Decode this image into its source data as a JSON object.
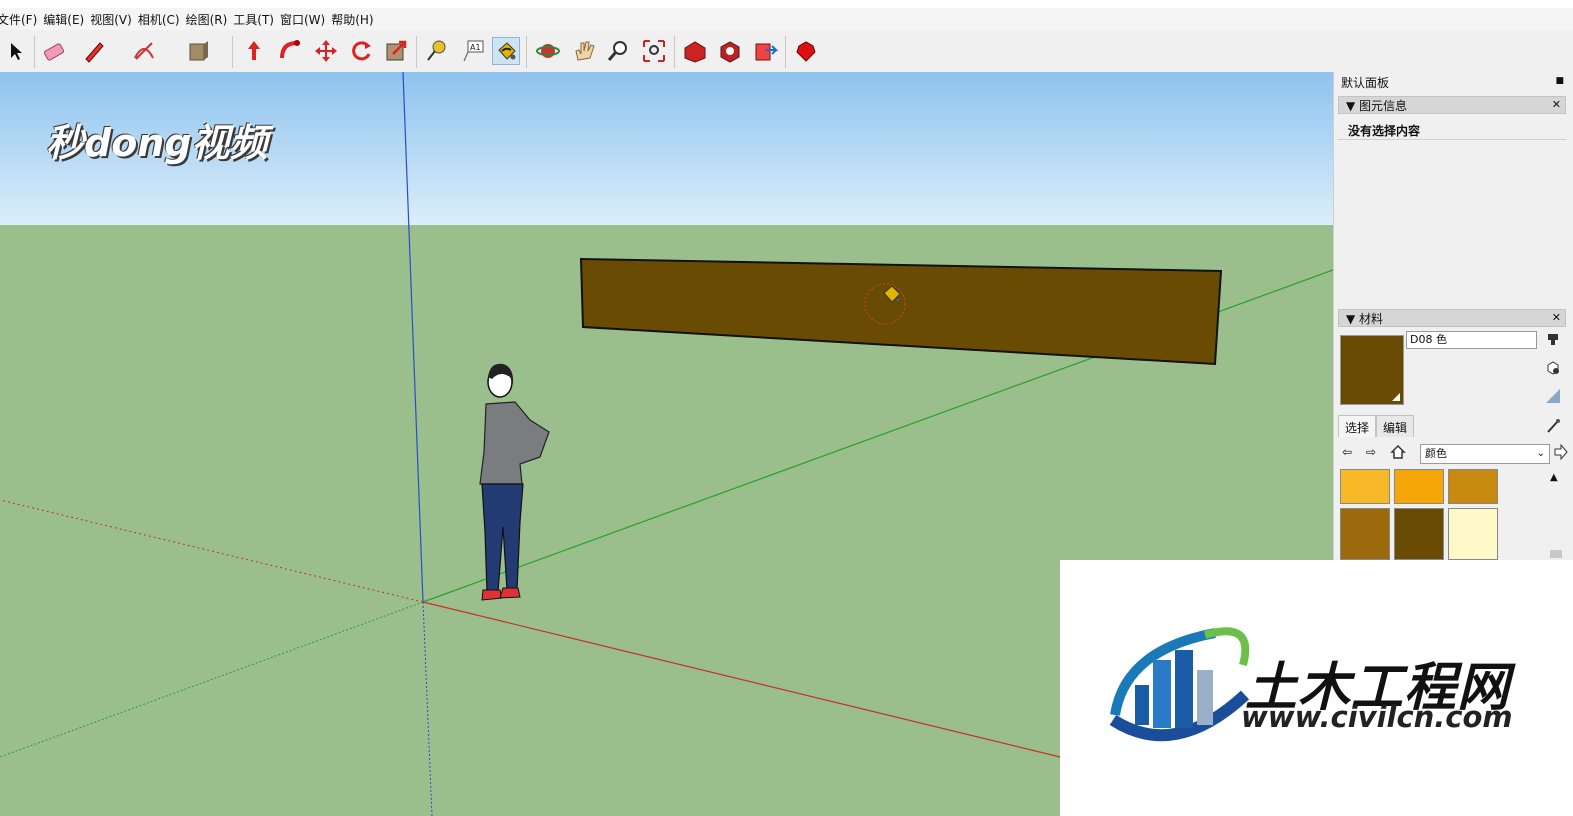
{
  "menubar": {
    "items": [
      "文件(F)",
      "编辑(E)",
      "视图(V)",
      "相机(C)",
      "绘图(R)",
      "工具(T)",
      "窗口(W)",
      "帮助(H)"
    ]
  },
  "toolbar": {
    "tools": [
      "select",
      "eraser",
      "pencil",
      "paint",
      "push-pull",
      "follow-me",
      "move",
      "rotate",
      "scale",
      "tape-measure",
      "text",
      "paint-bucket",
      "orbit",
      "pan",
      "zoom",
      "zoom-extents",
      "warehouse",
      "extension",
      "share",
      "ruby"
    ],
    "active_tool": "paint-bucket"
  },
  "watermark_top": "秒dong视频",
  "panel": {
    "title": "默认面板",
    "entity_info": {
      "title": "▼ 图元信息",
      "content": "没有选择内容"
    },
    "materials": {
      "title": "▼ 材料",
      "current_name": "D08 色",
      "current_color": "#6a4b03",
      "tabs": [
        "选择",
        "编辑"
      ],
      "library": "颜色",
      "swatches": [
        "#f7b928",
        "#f5a70a",
        "#c78a0e",
        "#9c6a0c",
        "#6a4b03",
        "#fff8c8"
      ]
    }
  },
  "logo": {
    "cn": "土木工程网",
    "url": "www.civilcn.com"
  }
}
